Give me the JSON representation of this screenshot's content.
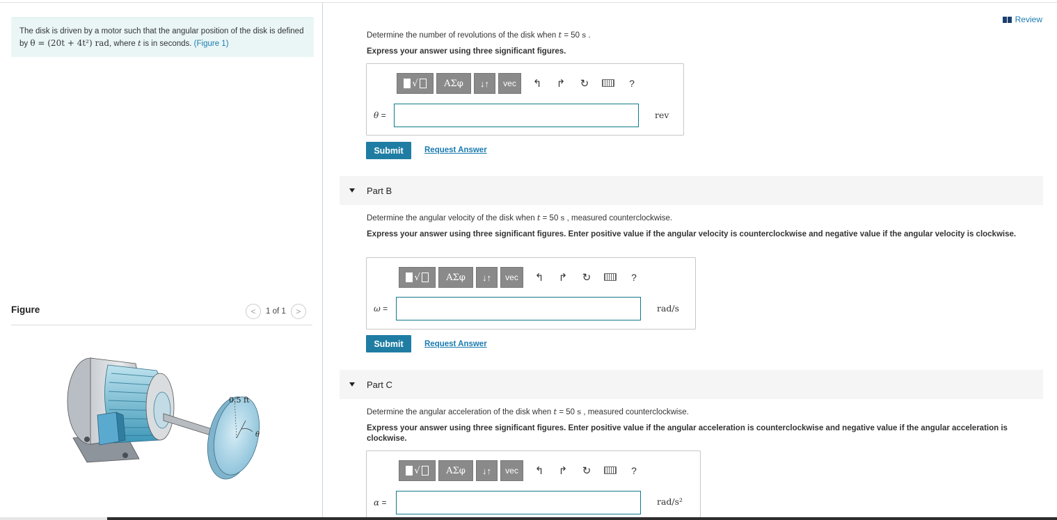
{
  "review": {
    "label": "Review"
  },
  "problem": {
    "text_before": "The disk is driven by a motor such that the angular position of the disk is defined by ",
    "equation": "θ = (20t + 4t²) rad",
    "text_mid": ", where ",
    "var_t": "t",
    "text_after": " is in seconds. ",
    "figure_link": "(Figure 1)"
  },
  "figure": {
    "label": "Figure",
    "prev": "<",
    "next": ">",
    "counter": "1 of 1",
    "dim_label": "0.5 ft",
    "angle_label": "θ"
  },
  "part_a": {
    "q_before": "Determine the number of revolutions of the disk when ",
    "q_var": "t",
    "q_eq": " = 50 ",
    "q_unit": "s",
    "q_after": " .",
    "instruction": "Express your answer using three significant figures.",
    "var": "θ",
    "var_eq": " =",
    "unit": "rev",
    "submit": "Submit",
    "request": "Request Answer"
  },
  "part_b": {
    "header": "Part B",
    "q_before": "Determine the angular velocity of the disk when ",
    "q_var": "t",
    "q_eq": " = 50 ",
    "q_unit": "s",
    "q_after": " , measured counterclockwise.",
    "instruction": "Express your answer using three significant figures. Enter positive value if the angular velocity is counterclockwise and negative value if the angular velocity is clockwise.",
    "var": "ω",
    "var_eq": " =",
    "unit": "rad/s",
    "submit": "Submit",
    "request": "Request Answer"
  },
  "part_c": {
    "header": "Part C",
    "q_before": "Determine the angular acceleration of the disk when ",
    "q_var": "t",
    "q_eq": " = 50 ",
    "q_unit": "s",
    "q_after": " , measured counterclockwise.",
    "instruction": "Express your answer using three significant figures. Enter positive value if the angular acceleration is counterclockwise and negative value if the angular acceleration is clockwise.",
    "var": "α",
    "var_eq": " =",
    "unit": "rad/s²"
  },
  "toolbar": {
    "greek": "ΑΣφ",
    "sort": "↓↑",
    "vec": "vec",
    "undo": "↰",
    "redo": "↱",
    "reset": "↻",
    "help": "?"
  },
  "colors": {
    "accent": "#1f7da3",
    "link": "#1a7bb0",
    "problem_bg": "#eaf6f6",
    "toolbar_btn": "#8a8a8a",
    "input_border": "#0f7a8a"
  }
}
